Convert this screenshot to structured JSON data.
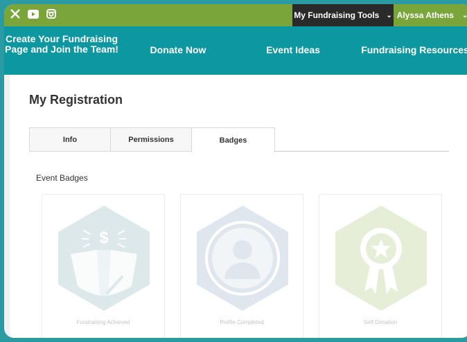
{
  "social": {
    "icons": [
      "x-logo-icon",
      "youtube-icon",
      "instagram-icon"
    ]
  },
  "topbar": {
    "tools_label": "My Fundraising Tools",
    "user_name": "Alyssa Athens",
    "chevron": "⌄"
  },
  "nav": {
    "items": [
      {
        "label": "Create Your Fundraising Page and Join the Team!"
      },
      {
        "label": "Donate Now"
      },
      {
        "label": "Event Ideas"
      },
      {
        "label": "Fundraising Resources"
      }
    ]
  },
  "page": {
    "title": "My Registration"
  },
  "tabs": [
    {
      "label": "Info"
    },
    {
      "label": "Permissions"
    },
    {
      "label": "Badges",
      "active": true
    }
  ],
  "badges": {
    "section_title": "Event Badges",
    "items": [
      {
        "label": "Fundraising Achieved",
        "icon": "fundraising-badge-icon",
        "color": "#dde8ea"
      },
      {
        "label": "Profile Completed",
        "icon": "profile-badge-icon",
        "color": "#dfe6ee"
      },
      {
        "label": "Self-Donation",
        "icon": "ribbon-badge-icon",
        "color": "#e6eed8"
      }
    ]
  },
  "colors": {
    "topbar": "#79a53b",
    "nav": "#0c97a1",
    "frame": "#2a9aa3"
  }
}
